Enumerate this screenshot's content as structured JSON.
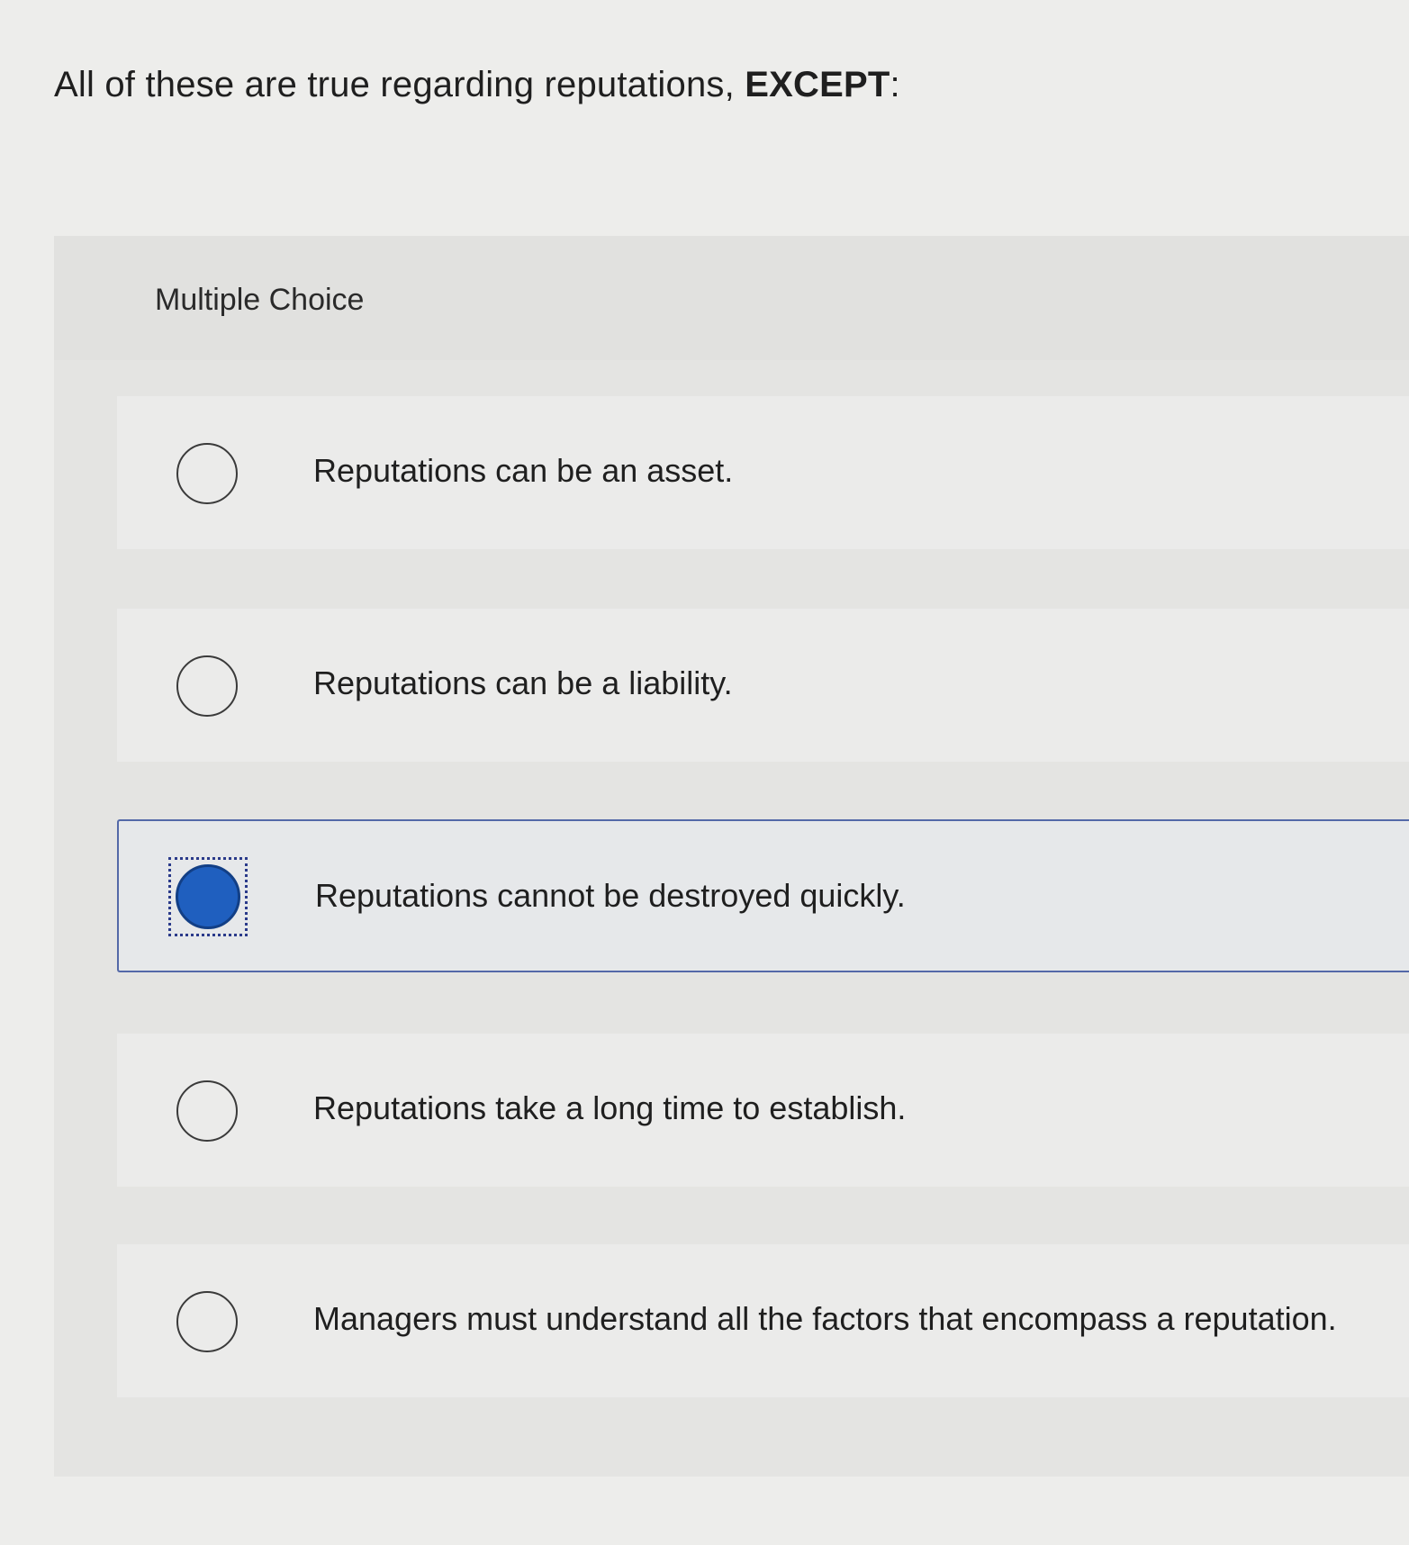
{
  "question": {
    "text": "All of these are true regarding reputations, ",
    "emphasis": "EXCEPT",
    "suffix": ":"
  },
  "panel": {
    "label": "Multiple Choice"
  },
  "options": [
    {
      "text": "Reputations can be an asset.",
      "selected": false
    },
    {
      "text": "Reputations can be a liability.",
      "selected": false
    },
    {
      "text": "Reputations cannot be destroyed quickly.",
      "selected": true
    },
    {
      "text": "Reputations take a long time to establish.",
      "selected": false
    },
    {
      "text": "Managers must understand all the factors that encompass a reputation.",
      "selected": false
    }
  ],
  "colors": {
    "selected_fill": "#1f5fbf",
    "selected_border": "#5469a8"
  },
  "icons": {
    "unselected": "radio-unselected-icon",
    "selected": "radio-selected-icon"
  }
}
